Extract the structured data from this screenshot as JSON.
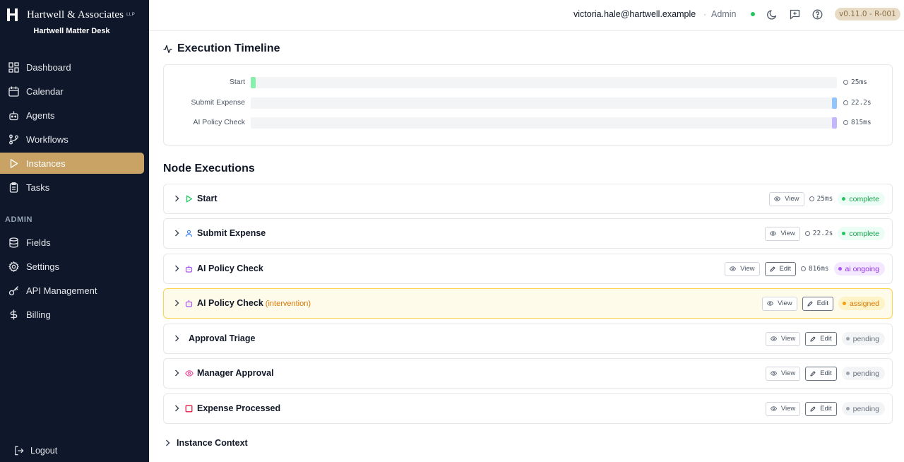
{
  "brand": {
    "name": "Hartwell & Associates",
    "suffix": "LLP",
    "subtitle": "Hartwell Matter Desk"
  },
  "sidebar": {
    "items": [
      {
        "label": "Dashboard",
        "icon": "dashboard-icon"
      },
      {
        "label": "Calendar",
        "icon": "calendar-icon"
      },
      {
        "label": "Agents",
        "icon": "robot-icon"
      },
      {
        "label": "Workflows",
        "icon": "workflow-icon"
      },
      {
        "label": "Instances",
        "icon": "play-icon",
        "active": true
      },
      {
        "label": "Tasks",
        "icon": "clipboard-icon"
      }
    ],
    "admin_heading": "ADMIN",
    "admin_items": [
      {
        "label": "Fields",
        "icon": "database-icon"
      },
      {
        "label": "Settings",
        "icon": "gear-icon"
      },
      {
        "label": "API Management",
        "icon": "key-icon"
      },
      {
        "label": "Billing",
        "icon": "dollar-icon"
      }
    ],
    "logout_label": "Logout"
  },
  "topbar": {
    "user_email": "victoria.hale@hartwell.example",
    "separator": "·",
    "role": "Admin",
    "version": "v0.11.0 - R-001",
    "accent": "#c9a366"
  },
  "timeline": {
    "title": "Execution Timeline",
    "rows": [
      {
        "label": "Start",
        "duration": "25ms",
        "start_pct": 0.0,
        "width_pct": 0.9,
        "color": "#86efac"
      },
      {
        "label": "Submit Expense",
        "duration": "22.2s",
        "start_pct": 99.2,
        "width_pct": 0.8,
        "color": "#93c5fd"
      },
      {
        "label": "AI Policy Check",
        "duration": "815ms",
        "start_pct": 99.2,
        "width_pct": 0.8,
        "color": "#c4b5fd"
      }
    ]
  },
  "nodes": {
    "title": "Node Executions",
    "view_label": "View",
    "edit_label": "Edit",
    "rows": [
      {
        "name": "Start",
        "note": "",
        "icon": "play-icon",
        "duration": "25ms",
        "status": "complete",
        "has_edit": false
      },
      {
        "name": "Submit Expense",
        "note": "",
        "icon": "user-icon",
        "duration": "22.2s",
        "status": "complete",
        "has_edit": false
      },
      {
        "name": "AI Policy Check",
        "note": "",
        "icon": "robot-icon",
        "duration": "816ms",
        "status": "ai ongoing",
        "has_edit": true
      },
      {
        "name": "AI Policy Check",
        "note": "(intervention)",
        "icon": "robot-icon",
        "duration": "",
        "status": "assigned",
        "has_edit": true
      },
      {
        "name": "Approval Triage",
        "note": "",
        "icon": "",
        "duration": "",
        "status": "pending",
        "has_edit": true
      },
      {
        "name": "Manager Approval",
        "note": "",
        "icon": "eye-icon",
        "duration": "",
        "status": "pending",
        "has_edit": true
      },
      {
        "name": "Expense Processed",
        "note": "",
        "icon": "square-icon",
        "duration": "",
        "status": "pending",
        "has_edit": true
      }
    ]
  },
  "context": {
    "label": "Instance Context"
  }
}
